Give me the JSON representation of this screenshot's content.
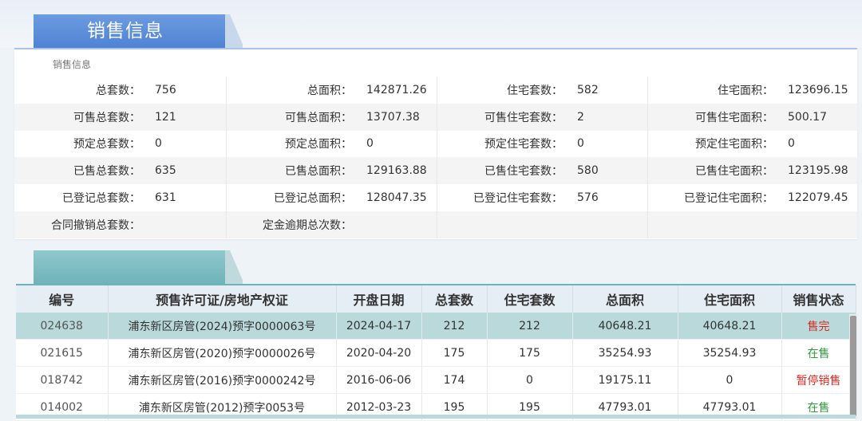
{
  "sales_section": {
    "tab_title": "销售信息",
    "subtitle": "销售信息",
    "rows": [
      [
        {
          "label": "总套数：",
          "value": "756"
        },
        {
          "label": "总面积：",
          "value": "142871.26"
        },
        {
          "label": "住宅套数：",
          "value": "582"
        },
        {
          "label": "住宅面积：",
          "value": "123696.15"
        }
      ],
      [
        {
          "label": "可售总套数：",
          "value": "121"
        },
        {
          "label": "可售总面积：",
          "value": "13707.38"
        },
        {
          "label": "可售住宅套数：",
          "value": "2"
        },
        {
          "label": "可售住宅面积：",
          "value": "500.17"
        }
      ],
      [
        {
          "label": "预定总套数：",
          "value": "0"
        },
        {
          "label": "预定总面积：",
          "value": "0"
        },
        {
          "label": "预定住宅套数：",
          "value": "0"
        },
        {
          "label": "预定住宅面积：",
          "value": "0"
        }
      ],
      [
        {
          "label": "已售总套数：",
          "value": "635"
        },
        {
          "label": "已售总面积：",
          "value": "129163.88"
        },
        {
          "label": "已售住宅套数：",
          "value": "580"
        },
        {
          "label": "已售住宅面积：",
          "value": "123195.98"
        }
      ],
      [
        {
          "label": "已登记总套数：",
          "value": "631"
        },
        {
          "label": "已登记总面积：",
          "value": "128047.35"
        },
        {
          "label": "已登记住宅套数：",
          "value": "576"
        },
        {
          "label": "已登记住宅面积：",
          "value": "122079.45"
        }
      ],
      [
        {
          "label": "合同撤销总套数：",
          "value": ""
        },
        {
          "label": "定金逾期总次数：",
          "value": ""
        },
        {
          "label": "",
          "value": ""
        },
        {
          "label": "",
          "value": ""
        }
      ]
    ]
  },
  "permit_section": {
    "tab_title": "",
    "columns": [
      "编号",
      "预售许可证/房地产权证",
      "开盘日期",
      "总套数",
      "住宅套数",
      "总面积",
      "住宅面积",
      "销售状态"
    ],
    "rows": [
      {
        "code": "024638",
        "permit": "浦东新区房管(2024)预字0000063号",
        "open_date": "2024-04-17",
        "total_units": "212",
        "residential_units": "212",
        "total_area": "40648.21",
        "residential_area": "40648.21",
        "status": "售完",
        "status_type": "sold"
      },
      {
        "code": "021615",
        "permit": "浦东新区房管(2020)预字0000026号",
        "open_date": "2020-04-20",
        "total_units": "175",
        "residential_units": "175",
        "total_area": "35254.93",
        "residential_area": "35254.93",
        "status": "在售",
        "status_type": "onsale"
      },
      {
        "code": "018742",
        "permit": "浦东新区房管(2016)预字0000242号",
        "open_date": "2016-06-06",
        "total_units": "174",
        "residential_units": "0",
        "total_area": "19175.11",
        "residential_area": "0",
        "status": "暂停销售",
        "status_type": "paused"
      },
      {
        "code": "014002",
        "permit": "浦东新区房管(2012)预字0053号",
        "open_date": "2012-03-23",
        "total_units": "195",
        "residential_units": "195",
        "total_area": "47793.01",
        "residential_area": "47793.01",
        "status": "在售",
        "status_type": "onsale"
      }
    ],
    "selected_row": 0
  },
  "colors": {
    "tab_blue": "#4f83d4",
    "tab_teal": "#6fb3b9",
    "status_red": "#d62a20",
    "status_green": "#2e9a3a"
  }
}
